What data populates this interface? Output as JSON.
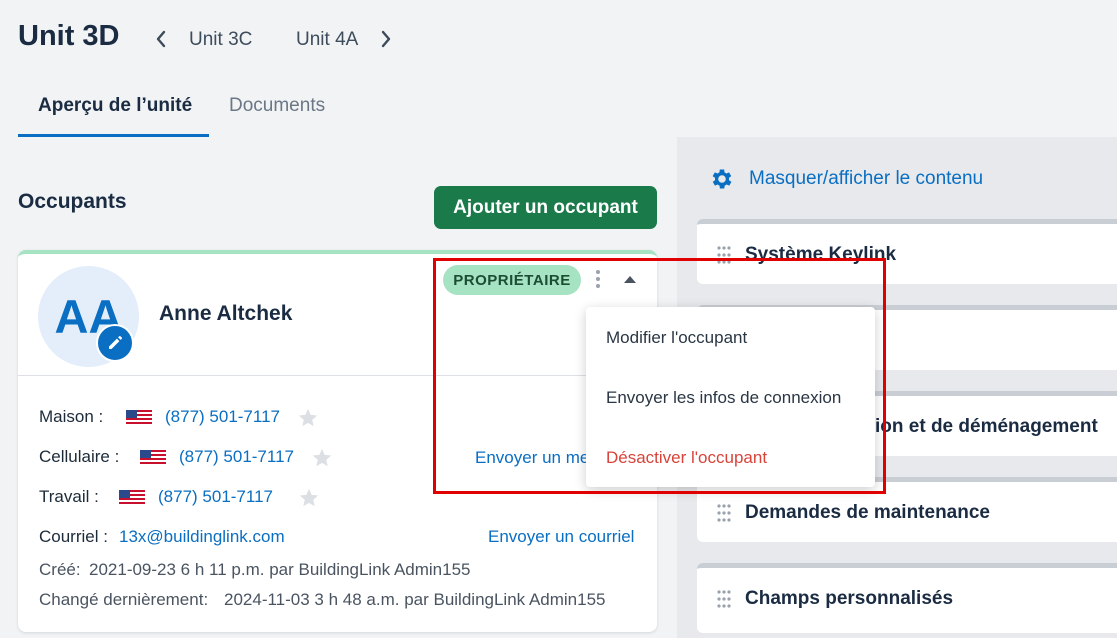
{
  "header": {
    "title": "Unit 3D",
    "prev_unit": "Unit 3C",
    "next_unit": "Unit 4A"
  },
  "tabs": [
    {
      "label": "Aperçu de l’unité",
      "active": true
    },
    {
      "label": "Documents",
      "active": false
    }
  ],
  "occupants": {
    "title": "Occupants",
    "add_button": "Ajouter un occupant",
    "card": {
      "initials": "AA",
      "name": "Anne Altchek",
      "badge": "PROPRIÉTAIRE",
      "phones": [
        {
          "label": "Maison :",
          "number": "(877) 501-7117"
        },
        {
          "label": "Cellulaire :",
          "number": "(877) 501-7117"
        },
        {
          "label": "Travail :",
          "number": "(877) 501-7117"
        }
      ],
      "send_message": "Envoyer un me",
      "email_label": "Courriel :",
      "email": "13x@buildinglink.com",
      "send_email": "Envoyer un courriel",
      "created_label": "Créé:",
      "created_value": "2021-09-23 6 h 11 p.m. par BuildingLink Admin155",
      "changed_label": "Changé dernièrement:",
      "changed_value": "2024-11-03 3 h 48 a.m. par BuildingLink Admin155"
    }
  },
  "dropdown": {
    "items": [
      {
        "label": "Modifier l'occupant"
      },
      {
        "label": "Envoyer les infos de connexion"
      },
      {
        "label": "Désactiver l'occupant"
      }
    ]
  },
  "side_panel": {
    "toggle_label": "Masquer/afficher le contenu",
    "widgets": [
      {
        "title": "Système Keylink"
      },
      {
        "title": "ion et de déménagement"
      },
      {
        "title": "Demandes de maintenance"
      },
      {
        "title": "Champs personnalisés"
      }
    ]
  },
  "colors": {
    "primary": "#0a6ec2",
    "accent_green": "#1a7a4a",
    "badge_green": "#a6e3c3",
    "danger": "#d8433a",
    "highlight": "#e00000"
  }
}
